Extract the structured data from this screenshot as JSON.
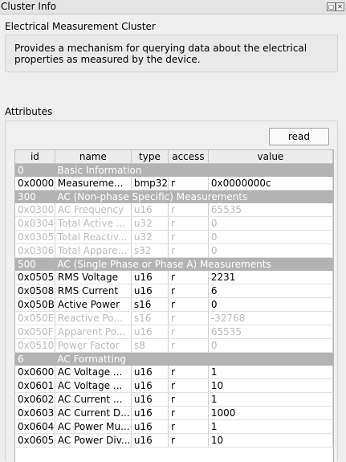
{
  "window": {
    "title": "Cluster Info"
  },
  "cluster": {
    "name": "Electrical Measurement Cluster",
    "description_line1": "Provides a mechanism for querying data about the electrical",
    "description_line2": "properties as measured by the device."
  },
  "attributes": {
    "label": "Attributes",
    "read_button": "read",
    "columns": [
      "id",
      "name",
      "type",
      "access",
      "value"
    ],
    "rows": [
      {
        "kind": "group",
        "id": "0",
        "name": "Basic Information"
      },
      {
        "kind": "attr",
        "active": true,
        "id": "0x0000",
        "name": "Measureme...",
        "type": "bmp32",
        "access": "r",
        "value": "0x0000000c"
      },
      {
        "kind": "group",
        "id": "300",
        "name": "AC (Non-phase Specific) Measurements"
      },
      {
        "kind": "attr",
        "active": false,
        "id": "0x0300",
        "name": "AC Frequency",
        "type": "u16",
        "access": "r",
        "value": "65535"
      },
      {
        "kind": "attr",
        "active": false,
        "id": "0x0304",
        "name": "Total Active ...",
        "type": "u32",
        "access": "r",
        "value": "0"
      },
      {
        "kind": "attr",
        "active": false,
        "id": "0x0305",
        "name": "Total Reactiv...",
        "type": "u32",
        "access": "r",
        "value": "0"
      },
      {
        "kind": "attr",
        "active": false,
        "id": "0x0306",
        "name": "Total Appare...",
        "type": "s32",
        "access": "r",
        "value": "0"
      },
      {
        "kind": "group",
        "id": "500",
        "name": "AC (Single Phase or Phase A) Measurements"
      },
      {
        "kind": "attr",
        "active": true,
        "id": "0x0505",
        "name": "RMS Voltage",
        "type": "u16",
        "access": "r",
        "value": "2231"
      },
      {
        "kind": "attr",
        "active": true,
        "id": "0x0508",
        "name": "RMS Current",
        "type": "u16",
        "access": "r",
        "value": "6"
      },
      {
        "kind": "attr",
        "active": true,
        "id": "0x050B",
        "name": "Active Power",
        "type": "s16",
        "access": "r",
        "value": "0"
      },
      {
        "kind": "attr",
        "active": false,
        "id": "0x050E",
        "name": "Reactive Po...",
        "type": "s16",
        "access": "r",
        "value": "-32768"
      },
      {
        "kind": "attr",
        "active": false,
        "id": "0x050F",
        "name": "Apparent Po...",
        "type": "u16",
        "access": "r",
        "value": "65535"
      },
      {
        "kind": "attr",
        "active": false,
        "id": "0x0510",
        "name": "Power Factor",
        "type": "s8",
        "access": "r",
        "value": "0"
      },
      {
        "kind": "group",
        "id": "6",
        "name": "AC Formatting"
      },
      {
        "kind": "attr",
        "active": true,
        "id": "0x0600",
        "name": "AC Voltage ...",
        "type": "u16",
        "access": "r",
        "value": "1"
      },
      {
        "kind": "attr",
        "active": true,
        "id": "0x0601",
        "name": "AC Voltage ...",
        "type": "u16",
        "access": "r",
        "value": "10"
      },
      {
        "kind": "attr",
        "active": true,
        "id": "0x0602",
        "name": "AC Current ...",
        "type": "u16",
        "access": "r",
        "value": "1"
      },
      {
        "kind": "attr",
        "active": true,
        "id": "0x0603",
        "name": "AC Current D...",
        "type": "u16",
        "access": "r",
        "value": "1000"
      },
      {
        "kind": "attr",
        "active": true,
        "id": "0x0604",
        "name": "AC Power Mu...",
        "type": "u16",
        "access": "r",
        "value": "1"
      },
      {
        "kind": "attr",
        "active": true,
        "id": "0x0605",
        "name": "AC Power Div...",
        "type": "u16",
        "access": "r",
        "value": "10"
      }
    ]
  },
  "icons": {
    "float": "float-icon",
    "close": "close-icon"
  }
}
